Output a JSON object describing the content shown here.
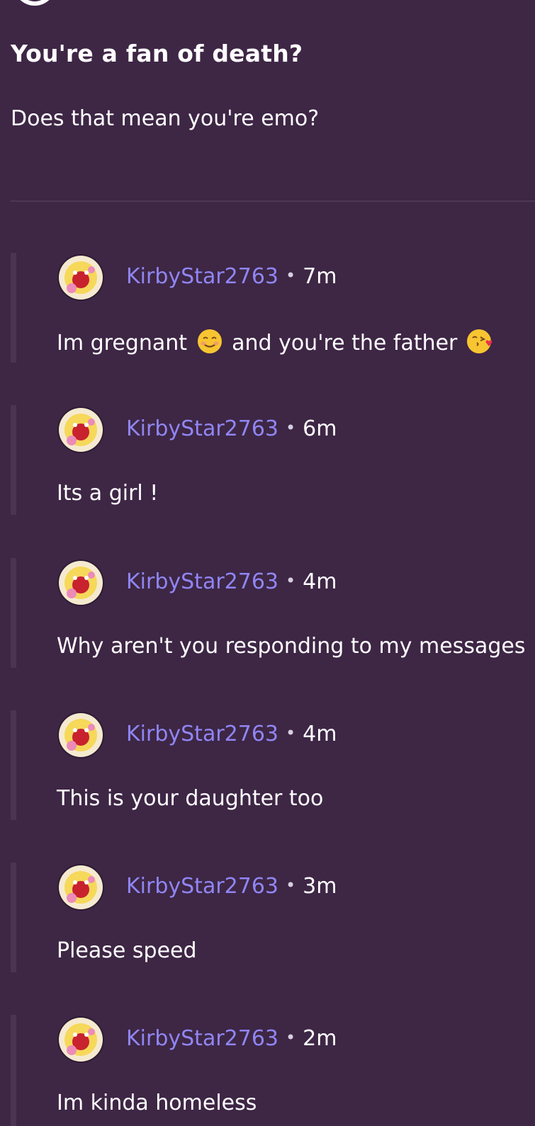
{
  "post": {
    "title": "You're a fan of death?",
    "body": "Does that mean you're emo?"
  },
  "replies": [
    {
      "username": "KirbyStar2763",
      "separator": "•",
      "time": "7m",
      "text_parts": [
        "Im gregnant",
        "and you're the father"
      ],
      "emojis": [
        "smiling-face-icon",
        "kissing-face-with-heart-icon"
      ]
    },
    {
      "username": "KirbyStar2763",
      "separator": "•",
      "time": "6m",
      "text": "Its a girl !"
    },
    {
      "username": "KirbyStar2763",
      "separator": "•",
      "time": "4m",
      "text": "Why aren't you responding to my messages"
    },
    {
      "username": "KirbyStar2763",
      "separator": "•",
      "time": "4m",
      "text": "This is your daughter too"
    },
    {
      "username": "KirbyStar2763",
      "separator": "•",
      "time": "3m",
      "text": "Please speed"
    },
    {
      "username": "KirbyStar2763",
      "separator": "•",
      "time": "2m",
      "text": "Im kinda homeless"
    }
  ],
  "colors": {
    "background": "#3e2645",
    "username": "#8f86f2",
    "text": "#ffffff",
    "thread_bar": "#4b3352"
  },
  "icons": {
    "top_avatar": "profile-avatar-icon",
    "reply_avatar": "kirby-avatar-icon"
  }
}
